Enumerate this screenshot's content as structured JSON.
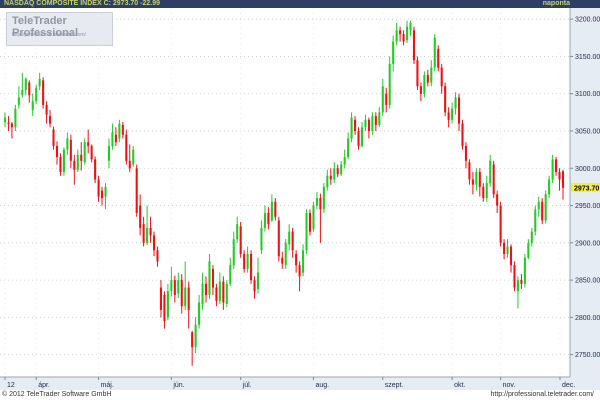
{
  "header": {
    "title": "NASDAQ COMPOSITE INDEX C: 2973.70 -22.99",
    "interval": "naponta"
  },
  "logo": {
    "title": "TeleTrader Professional",
    "url": "http://professional.teletrader.com/"
  },
  "footer": {
    "copyright": "© 2012 TeleTrader Software GmbH",
    "url": "http://professional.teletrader.com/"
  },
  "colors": {
    "up": "#22cc22",
    "down": "#ee1111",
    "header_bg": "#2e3f66",
    "axis_bg": "#e6ecf4",
    "price_tag_bg": "#f6ef3a"
  },
  "chart_data": {
    "type": "candlestick",
    "title": "NASDAQ COMPOSITE INDEX",
    "last_price": "2973.70",
    "change": "-22.99",
    "ylim": [
      2720,
      3215
    ],
    "y_ticks": [
      "3200.00",
      "3150.00",
      "3100.00",
      "3050.00",
      "3000.00",
      "2950.00",
      "2900.00",
      "2850.00",
      "2800.00",
      "2750.00"
    ],
    "x_ticks": [
      "12",
      "ápr.",
      "máj.",
      "jún.",
      "júl.",
      "aug.",
      "szept.",
      "okt.",
      "nov.",
      "dec."
    ],
    "grid": true,
    "candles": [
      {
        "o": 3062,
        "c": 3068,
        "h": 3075,
        "l": 3055
      },
      {
        "o": 3061,
        "c": 3060,
        "h": 3070,
        "l": 3050
      },
      {
        "o": 3060,
        "c": 3055,
        "h": 3062,
        "l": 3040
      },
      {
        "o": 3055,
        "c": 3080,
        "h": 3085,
        "l": 3050
      },
      {
        "o": 3085,
        "c": 3095,
        "h": 3110,
        "l": 3080
      },
      {
        "o": 3098,
        "c": 3105,
        "h": 3128,
        "l": 3095
      },
      {
        "o": 3105,
        "c": 3120,
        "h": 3122,
        "l": 3098
      },
      {
        "o": 3115,
        "c": 3098,
        "h": 3118,
        "l": 3088
      },
      {
        "o": 3078,
        "c": 3090,
        "h": 3100,
        "l": 3070
      },
      {
        "o": 3090,
        "c": 3108,
        "h": 3112,
        "l": 3086
      },
      {
        "o": 3110,
        "c": 3120,
        "h": 3128,
        "l": 3105
      },
      {
        "o": 3118,
        "c": 3085,
        "h": 3122,
        "l": 3080
      },
      {
        "o": 3085,
        "c": 3072,
        "h": 3090,
        "l": 3060
      },
      {
        "o": 3070,
        "c": 3060,
        "h": 3078,
        "l": 3055
      },
      {
        "o": 3052,
        "c": 3030,
        "h": 3056,
        "l": 3025
      },
      {
        "o": 3030,
        "c": 3015,
        "h": 3036,
        "l": 3005
      },
      {
        "o": 3015,
        "c": 2995,
        "h": 3020,
        "l": 2990
      },
      {
        "o": 2995,
        "c": 3025,
        "h": 3028,
        "l": 2990
      },
      {
        "o": 3025,
        "c": 3040,
        "h": 3048,
        "l": 3018
      },
      {
        "o": 3038,
        "c": 3010,
        "h": 3045,
        "l": 3000
      },
      {
        "o": 3010,
        "c": 2998,
        "h": 3018,
        "l": 2978
      },
      {
        "o": 2998,
        "c": 3018,
        "h": 3025,
        "l": 2995
      },
      {
        "o": 3018,
        "c": 3010,
        "h": 3035,
        "l": 2997
      },
      {
        "o": 3008,
        "c": 3035,
        "h": 3040,
        "l": 3005
      },
      {
        "o": 3035,
        "c": 3030,
        "h": 3052,
        "l": 3020
      },
      {
        "o": 3030,
        "c": 3012,
        "h": 3032,
        "l": 3008
      },
      {
        "o": 3012,
        "c": 2985,
        "h": 3016,
        "l": 2980
      },
      {
        "o": 2985,
        "c": 2962,
        "h": 2990,
        "l": 2955
      },
      {
        "o": 2970,
        "c": 2960,
        "h": 2975,
        "l": 2950
      },
      {
        "o": 2962,
        "c": 2975,
        "h": 2980,
        "l": 2945
      },
      {
        "o": 3010,
        "c": 3030,
        "h": 3040,
        "l": 3000
      },
      {
        "o": 3030,
        "c": 3048,
        "h": 3060,
        "l": 3025
      },
      {
        "o": 3045,
        "c": 3035,
        "h": 3055,
        "l": 3030
      },
      {
        "o": 3040,
        "c": 3060,
        "h": 3065,
        "l": 3035
      },
      {
        "o": 3058,
        "c": 3045,
        "h": 3062,
        "l": 3040
      },
      {
        "o": 3045,
        "c": 3010,
        "h": 3052,
        "l": 3005
      },
      {
        "o": 3010,
        "c": 3000,
        "h": 3032,
        "l": 2995
      },
      {
        "o": 3005,
        "c": 3025,
        "h": 3030,
        "l": 3002
      },
      {
        "o": 3000,
        "c": 2940,
        "h": 3005,
        "l": 2935
      },
      {
        "o": 2950,
        "c": 2920,
        "h": 2965,
        "l": 2910
      },
      {
        "o": 2925,
        "c": 2900,
        "h": 2935,
        "l": 2895
      },
      {
        "o": 2900,
        "c": 2920,
        "h": 2950,
        "l": 2897
      },
      {
        "o": 2920,
        "c": 2910,
        "h": 2935,
        "l": 2900
      },
      {
        "o": 2910,
        "c": 2890,
        "h": 2915,
        "l": 2882
      },
      {
        "o": 2890,
        "c": 2875,
        "h": 2895,
        "l": 2868
      },
      {
        "o": 2840,
        "c": 2810,
        "h": 2850,
        "l": 2800
      },
      {
        "o": 2830,
        "c": 2795,
        "h": 2835,
        "l": 2785
      },
      {
        "o": 2800,
        "c": 2835,
        "h": 2845,
        "l": 2796
      },
      {
        "o": 2835,
        "c": 2850,
        "h": 2868,
        "l": 2828
      },
      {
        "o": 2850,
        "c": 2830,
        "h": 2856,
        "l": 2820
      },
      {
        "o": 2832,
        "c": 2850,
        "h": 2860,
        "l": 2826
      },
      {
        "o": 2850,
        "c": 2815,
        "h": 2858,
        "l": 2805
      },
      {
        "o": 2815,
        "c": 2840,
        "h": 2875,
        "l": 2810
      },
      {
        "o": 2840,
        "c": 2810,
        "h": 2848,
        "l": 2785
      },
      {
        "o": 2780,
        "c": 2760,
        "h": 2782,
        "l": 2735
      },
      {
        "o": 2760,
        "c": 2790,
        "h": 2800,
        "l": 2752
      },
      {
        "o": 2790,
        "c": 2820,
        "h": 2830,
        "l": 2785
      },
      {
        "o": 2818,
        "c": 2845,
        "h": 2860,
        "l": 2810
      },
      {
        "o": 2845,
        "c": 2830,
        "h": 2855,
        "l": 2820
      },
      {
        "o": 2830,
        "c": 2875,
        "h": 2885,
        "l": 2825
      },
      {
        "o": 2865,
        "c": 2840,
        "h": 2870,
        "l": 2830
      },
      {
        "o": 2840,
        "c": 2822,
        "h": 2845,
        "l": 2815
      },
      {
        "o": 2822,
        "c": 2848,
        "h": 2860,
        "l": 2818
      },
      {
        "o": 2848,
        "c": 2820,
        "h": 2855,
        "l": 2810
      },
      {
        "o": 2818,
        "c": 2845,
        "h": 2850,
        "l": 2814
      },
      {
        "o": 2845,
        "c": 2870,
        "h": 2880,
        "l": 2842
      },
      {
        "o": 2870,
        "c": 2905,
        "h": 2915,
        "l": 2865
      },
      {
        "o": 2905,
        "c": 2925,
        "h": 2935,
        "l": 2900
      },
      {
        "o": 2922,
        "c": 2885,
        "h": 2928,
        "l": 2880
      },
      {
        "o": 2885,
        "c": 2865,
        "h": 2890,
        "l": 2860
      },
      {
        "o": 2865,
        "c": 2885,
        "h": 2895,
        "l": 2860
      },
      {
        "o": 2885,
        "c": 2850,
        "h": 2890,
        "l": 2845
      },
      {
        "o": 2850,
        "c": 2835,
        "h": 2855,
        "l": 2825
      },
      {
        "o": 2838,
        "c": 2860,
        "h": 2880,
        "l": 2832
      },
      {
        "o": 2890,
        "c": 2920,
        "h": 2930,
        "l": 2885
      },
      {
        "o": 2920,
        "c": 2940,
        "h": 2950,
        "l": 2915
      },
      {
        "o": 2940,
        "c": 2925,
        "h": 2948,
        "l": 2918
      },
      {
        "o": 2930,
        "c": 2955,
        "h": 2965,
        "l": 2928
      },
      {
        "o": 2955,
        "c": 2935,
        "h": 2960,
        "l": 2930
      },
      {
        "o": 2930,
        "c": 2882,
        "h": 2935,
        "l": 2875
      },
      {
        "o": 2880,
        "c": 2872,
        "h": 2888,
        "l": 2865
      },
      {
        "o": 2870,
        "c": 2900,
        "h": 2905,
        "l": 2865
      },
      {
        "o": 2898,
        "c": 2915,
        "h": 2925,
        "l": 2890
      },
      {
        "o": 2915,
        "c": 2890,
        "h": 2920,
        "l": 2880
      },
      {
        "o": 2885,
        "c": 2870,
        "h": 2890,
        "l": 2860
      },
      {
        "o": 2870,
        "c": 2855,
        "h": 2875,
        "l": 2835
      },
      {
        "o": 2860,
        "c": 2890,
        "h": 2898,
        "l": 2855
      },
      {
        "o": 2890,
        "c": 2940,
        "h": 2945,
        "l": 2885
      },
      {
        "o": 2940,
        "c": 2915,
        "h": 2945,
        "l": 2910
      },
      {
        "o": 2918,
        "c": 2950,
        "h": 2955,
        "l": 2915
      },
      {
        "o": 2950,
        "c": 2960,
        "h": 2968,
        "l": 2945
      },
      {
        "o": 2960,
        "c": 2945,
        "h": 2966,
        "l": 2900
      },
      {
        "o": 2945,
        "c": 2975,
        "h": 2980,
        "l": 2940
      },
      {
        "o": 2975,
        "c": 2990,
        "h": 2998,
        "l": 2970
      },
      {
        "o": 2990,
        "c": 2985,
        "h": 3000,
        "l": 2978
      },
      {
        "o": 2985,
        "c": 3000,
        "h": 3008,
        "l": 2980
      },
      {
        "o": 3000,
        "c": 2992,
        "h": 3005,
        "l": 2988
      },
      {
        "o": 2992,
        "c": 3005,
        "h": 3010,
        "l": 2990
      },
      {
        "o": 3005,
        "c": 3015,
        "h": 3025,
        "l": 3000
      },
      {
        "o": 3015,
        "c": 3040,
        "h": 3048,
        "l": 3012
      },
      {
        "o": 3040,
        "c": 3068,
        "h": 3075,
        "l": 3035
      },
      {
        "o": 3065,
        "c": 3050,
        "h": 3070,
        "l": 3045
      },
      {
        "o": 3050,
        "c": 3030,
        "h": 3055,
        "l": 3025
      },
      {
        "o": 3030,
        "c": 3055,
        "h": 3062,
        "l": 3028
      },
      {
        "o": 3055,
        "c": 3065,
        "h": 3072,
        "l": 3050
      },
      {
        "o": 3065,
        "c": 3050,
        "h": 3068,
        "l": 3040
      },
      {
        "o": 3050,
        "c": 3070,
        "h": 3075,
        "l": 3045
      },
      {
        "o": 3070,
        "c": 3058,
        "h": 3075,
        "l": 3050
      },
      {
        "o": 3058,
        "c": 3075,
        "h": 3082,
        "l": 3055
      },
      {
        "o": 3075,
        "c": 3110,
        "h": 3120,
        "l": 3070
      },
      {
        "o": 3100,
        "c": 3085,
        "h": 3108,
        "l": 3075
      },
      {
        "o": 3085,
        "c": 3140,
        "h": 3150,
        "l": 3080
      },
      {
        "o": 3140,
        "c": 3170,
        "h": 3178,
        "l": 3130
      },
      {
        "o": 3170,
        "c": 3185,
        "h": 3195,
        "l": 3165
      },
      {
        "o": 3185,
        "c": 3180,
        "h": 3190,
        "l": 3170
      },
      {
        "o": 3180,
        "c": 3170,
        "h": 3185,
        "l": 3165
      },
      {
        "o": 3172,
        "c": 3190,
        "h": 3198,
        "l": 3168
      },
      {
        "o": 3185,
        "c": 3195,
        "h": 3198,
        "l": 3178
      },
      {
        "o": 3185,
        "c": 3145,
        "h": 3190,
        "l": 3140
      },
      {
        "o": 3145,
        "c": 3110,
        "h": 3150,
        "l": 3105
      },
      {
        "o": 3110,
        "c": 3100,
        "h": 3115,
        "l": 3090
      },
      {
        "o": 3100,
        "c": 3125,
        "h": 3130,
        "l": 3095
      },
      {
        "o": 3125,
        "c": 3115,
        "h": 3132,
        "l": 3110
      },
      {
        "o": 3115,
        "c": 3135,
        "h": 3145,
        "l": 3110
      },
      {
        "o": 3135,
        "c": 3175,
        "h": 3180,
        "l": 3130
      },
      {
        "o": 3160,
        "c": 3135,
        "h": 3165,
        "l": 3130
      },
      {
        "o": 3135,
        "c": 3110,
        "h": 3140,
        "l": 3100
      },
      {
        "o": 3110,
        "c": 3075,
        "h": 3115,
        "l": 3070
      },
      {
        "o": 3075,
        "c": 3065,
        "h": 3082,
        "l": 3055
      },
      {
        "o": 3065,
        "c": 3080,
        "h": 3088,
        "l": 3060
      },
      {
        "o": 3080,
        "c": 3095,
        "h": 3102,
        "l": 3072
      },
      {
        "o": 3095,
        "c": 3060,
        "h": 3100,
        "l": 3050
      },
      {
        "o": 3060,
        "c": 3030,
        "h": 3065,
        "l": 3025
      },
      {
        "o": 3030,
        "c": 3010,
        "h": 3035,
        "l": 3000
      },
      {
        "o": 3008,
        "c": 2985,
        "h": 3012,
        "l": 2978
      },
      {
        "o": 2985,
        "c": 2978,
        "h": 2995,
        "l": 2965
      },
      {
        "o": 2978,
        "c": 2995,
        "h": 3000,
        "l": 2970
      },
      {
        "o": 2995,
        "c": 2975,
        "h": 3000,
        "l": 2962
      },
      {
        "o": 2975,
        "c": 2960,
        "h": 2980,
        "l": 2955
      },
      {
        "o": 2960,
        "c": 2980,
        "h": 2990,
        "l": 2955
      },
      {
        "o": 2980,
        "c": 3010,
        "h": 3018,
        "l": 2975
      },
      {
        "o": 3005,
        "c": 2965,
        "h": 3010,
        "l": 2960
      },
      {
        "o": 2965,
        "c": 2950,
        "h": 2970,
        "l": 2940
      },
      {
        "o": 2950,
        "c": 2900,
        "h": 2955,
        "l": 2895
      },
      {
        "o": 2900,
        "c": 2885,
        "h": 2905,
        "l": 2878
      },
      {
        "o": 2885,
        "c": 2895,
        "h": 2905,
        "l": 2880
      },
      {
        "o": 2895,
        "c": 2870,
        "h": 2898,
        "l": 2860
      },
      {
        "o": 2870,
        "c": 2840,
        "h": 2875,
        "l": 2835
      },
      {
        "o": 2835,
        "c": 2850,
        "h": 2855,
        "l": 2812
      },
      {
        "o": 2850,
        "c": 2845,
        "h": 2858,
        "l": 2838
      },
      {
        "o": 2845,
        "c": 2880,
        "h": 2885,
        "l": 2840
      },
      {
        "o": 2880,
        "c": 2900,
        "h": 2905,
        "l": 2878
      },
      {
        "o": 2900,
        "c": 2915,
        "h": 2920,
        "l": 2895
      },
      {
        "o": 2915,
        "c": 2945,
        "h": 2950,
        "l": 2910
      },
      {
        "o": 2945,
        "c": 2955,
        "h": 2962,
        "l": 2935
      },
      {
        "o": 2955,
        "c": 2930,
        "h": 2960,
        "l": 2925
      },
      {
        "o": 2930,
        "c": 2965,
        "h": 2970,
        "l": 2926
      },
      {
        "o": 2965,
        "c": 2985,
        "h": 2990,
        "l": 2960
      },
      {
        "o": 2985,
        "c": 3012,
        "h": 3018,
        "l": 2980
      },
      {
        "o": 3012,
        "c": 2995,
        "h": 3015,
        "l": 2990
      },
      {
        "o": 2995,
        "c": 2985,
        "h": 3000,
        "l": 2970
      },
      {
        "o": 2996,
        "c": 2973.7,
        "h": 2998,
        "l": 2958
      }
    ]
  }
}
